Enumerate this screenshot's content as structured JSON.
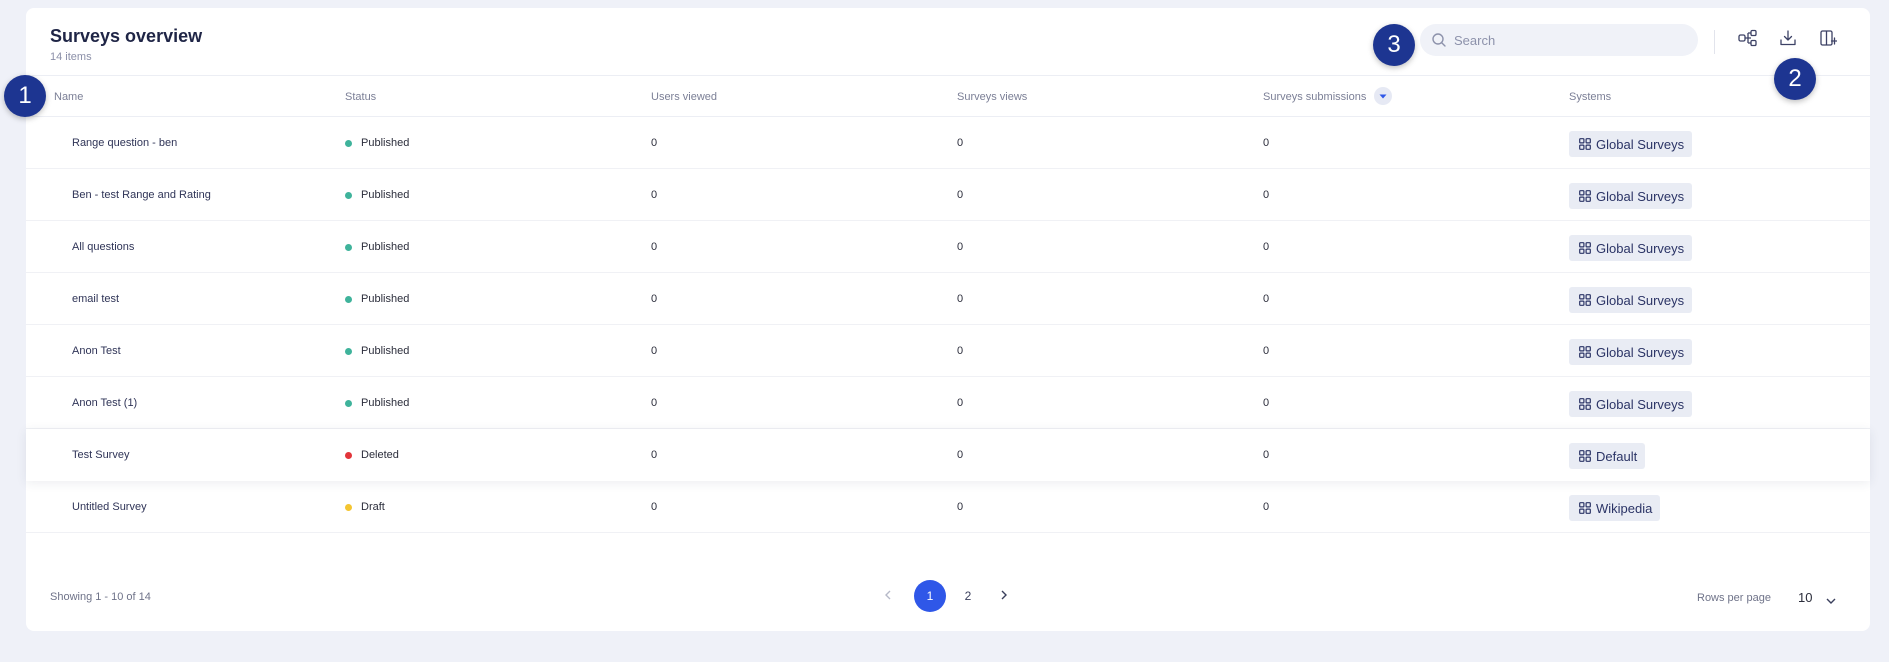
{
  "page": {
    "title": "Surveys overview",
    "subtitle": "14 items"
  },
  "search": {
    "placeholder": "Search",
    "value": ""
  },
  "toolbar": {
    "icons": [
      "hierarchy-icon",
      "download-icon",
      "column-settings-icon"
    ]
  },
  "table": {
    "columns": [
      "Name",
      "Status",
      "Users viewed",
      "Surveys views",
      "Surveys submissions",
      "Systems"
    ],
    "rows": [
      {
        "name": "Range question - ben",
        "status": "Published",
        "users_viewed": "0",
        "views": "0",
        "submissions": "0",
        "system": "Global Surveys"
      },
      {
        "name": "Ben - test Range and Rating",
        "status": "Published",
        "users_viewed": "0",
        "views": "0",
        "submissions": "0",
        "system": "Global Surveys"
      },
      {
        "name": "All questions",
        "status": "Published",
        "users_viewed": "0",
        "views": "0",
        "submissions": "0",
        "system": "Global Surveys"
      },
      {
        "name": "email test",
        "status": "Published",
        "users_viewed": "0",
        "views": "0",
        "submissions": "0",
        "system": "Global Surveys"
      },
      {
        "name": "Anon Test",
        "status": "Published",
        "users_viewed": "0",
        "views": "0",
        "submissions": "0",
        "system": "Global Surveys"
      },
      {
        "name": "Anon Test (1)",
        "status": "Published",
        "users_viewed": "0",
        "views": "0",
        "submissions": "0",
        "system": "Global Surveys"
      },
      {
        "name": "Test Survey",
        "status": "Deleted",
        "users_viewed": "0",
        "views": "0",
        "submissions": "0",
        "system": "Default"
      },
      {
        "name": "Untitled Survey",
        "status": "Draft",
        "users_viewed": "0",
        "views": "0",
        "submissions": "0",
        "system": "Wikipedia"
      }
    ]
  },
  "status_colors": {
    "Published": "#3fb39b",
    "Deleted": "#e2353a",
    "Draft": "#f4c531"
  },
  "footer": {
    "showing": "Showing 1 - 10 of 14",
    "pages": [
      "1",
      "2"
    ],
    "current_page": "1",
    "rows_per_page_label": "Rows per page",
    "rows_per_page_value": "10"
  },
  "callouts": [
    "1",
    "2",
    "3"
  ],
  "colors": {
    "accent": "#2f57e8",
    "callout": "#1d3591"
  }
}
